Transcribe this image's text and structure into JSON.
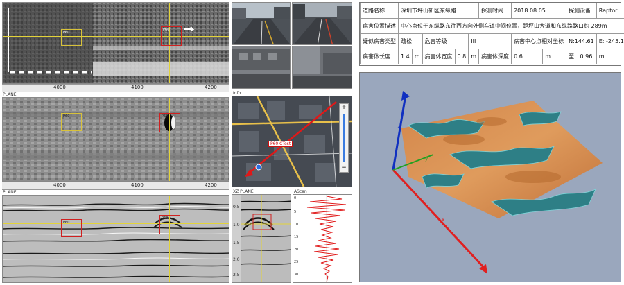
{
  "scan_top": {
    "ruler_ticks": [
      "4000",
      "4100",
      "4200"
    ],
    "box_labels": [
      "P60",
      "P60"
    ]
  },
  "plane_mid": {
    "panel_label": "PLANE",
    "ruler_ticks": [
      "4000",
      "4100",
      "4200"
    ],
    "box_labels": [
      "P60",
      "P60"
    ]
  },
  "plane_bottom": {
    "panel_label": "PLANE",
    "box_labels": [
      "P60",
      "P60"
    ]
  },
  "map": {
    "panel_label": "Info",
    "marker_label": "P60 CTest",
    "zoom_plus": "+",
    "zoom_minus": "−"
  },
  "xz_panel": {
    "panel_label": "XZ PLANE",
    "depth_ticks": [
      "0.5",
      "1.0",
      "1.5",
      "2.0",
      "2.5"
    ]
  },
  "ascan_panel": {
    "panel_label": "AScan",
    "ticks": [
      "0",
      "5",
      "10",
      "15",
      "20",
      "25",
      "30"
    ]
  },
  "info_table": {
    "rows": [
      [
        "道路名称",
        "深圳市坪山新区东纵路",
        "探测时间",
        "2018.08.05",
        "探测设备",
        "Raptor"
      ],
      [
        "病害位置描述",
        "中心点位于东纵路东往西方向外侧车道中间位置，距坪山大道和东纵路路口约 289m"
      ],
      [
        "疑似病害类型",
        "疏松",
        "危害等级",
        "III",
        "病害中心点相对坐标",
        "N:144.61",
        "E: -245.11"
      ],
      [
        "病害体长度",
        "1.4",
        "m",
        "病害体宽度",
        "0.8",
        "m",
        "病害体深度",
        "0.6",
        "m",
        "至",
        "0.96",
        "m"
      ]
    ]
  },
  "view3d": {
    "axis_ticks": [
      "x",
      "y",
      "z"
    ],
    "colors": {
      "background": "#9aa7bd",
      "x_axis": "#e02020",
      "y_axis": "#20a020",
      "z_axis": "#1030c0"
    }
  }
}
